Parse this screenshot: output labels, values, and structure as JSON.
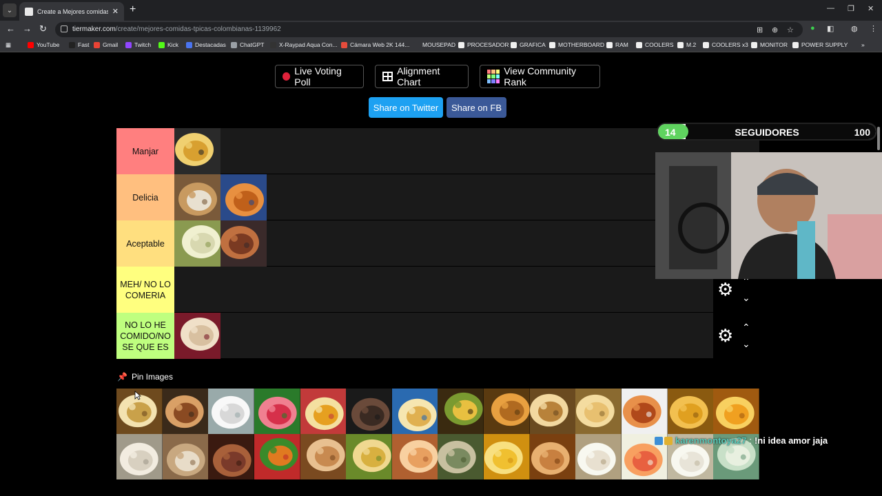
{
  "browser": {
    "tab_title": "Create a Mejores comidas típicas",
    "url_host": "tiermaker.com",
    "url_path": "/create/mejores-comidas-tpicas-colombianas-1139962",
    "bookmarks": [
      "YouTube",
      "Fast",
      "Gmail",
      "Twitch",
      "Kick",
      "Destacadas",
      "ChatGPT",
      "X-Raypad Aqua Con...",
      "Cámara Web 2K 144...",
      "MOUSEPAD",
      "PROCESADOR",
      "GRAFICA",
      "MOTHERBOARD",
      "RAM",
      "COOLERS",
      "M.2",
      "COOLERS x3",
      "MONITOR",
      "POWER SUPPLY"
    ],
    "bookmark_icon_colors": [
      "#ff0000",
      "#222222",
      "#ea4335",
      "#9146ff",
      "#53fc18",
      "#4a74f0",
      "#9aa0a6",
      "#333333",
      "#e74c3c",
      "#35363a",
      "#f0f0f0",
      "#f0f0f0",
      "#f0f0f0",
      "#f0f0f0",
      "#f0f0f0",
      "#f0f0f0",
      "#f0f0f0",
      "#f0f0f0",
      "#f0f0f0"
    ]
  },
  "toolbar": {
    "live_voting": "Live Voting Poll",
    "alignment": "Alignment Chart",
    "community_rank": "View Community Rank",
    "share_twitter": "Share on Twitter",
    "share_fb": "Share on FB"
  },
  "colors": {
    "twitter": "#1da1f2",
    "facebook": "#3b5998"
  },
  "tiers": [
    {
      "label": "Manjar",
      "color": "#ff7f7f",
      "items": [
        "soup-bowl"
      ]
    },
    {
      "label": "Delicia",
      "color": "#ffbf7f",
      "items": [
        "soup-bread",
        "drink-bottle"
      ]
    },
    {
      "label": "Aceptable",
      "color": "#ffdf7f",
      "items": [
        "sancocho",
        "roast-pork"
      ]
    },
    {
      "label": "MEH/ NO LO COMERIA",
      "color": "#ffff7f",
      "items": []
    },
    {
      "label": "NO LO HE COMIDO/NO SE QUE ES",
      "color": "#bfff7f",
      "items": [
        "buñuelos"
      ]
    }
  ],
  "pin_images": {
    "label": "Pin Images",
    "items": [
      "green-soup",
      "roast-meat",
      "water-glass",
      "fruit-punch",
      "fruit-cup",
      "ants",
      "empanada-plate",
      "fried-plantain",
      "fried-snack",
      "arepa",
      "pandebono",
      "tea",
      "buñuelo",
      "empanadas",
      "arepa-white",
      "milk-drink",
      "lentils",
      "bandeja",
      "rosquillas",
      "rice",
      "eggs",
      "mondongo",
      "juice",
      "tamal",
      "changua",
      "ceviche",
      "avena",
      "soup-cream"
    ]
  },
  "follower_goal": {
    "title": "SEGUIDORES",
    "current": "14",
    "goal": "100",
    "progress": 0.14
  },
  "chat": {
    "user": "karenmontoya27",
    "separator": ":",
    "message": "!ni idea amor jaja"
  }
}
